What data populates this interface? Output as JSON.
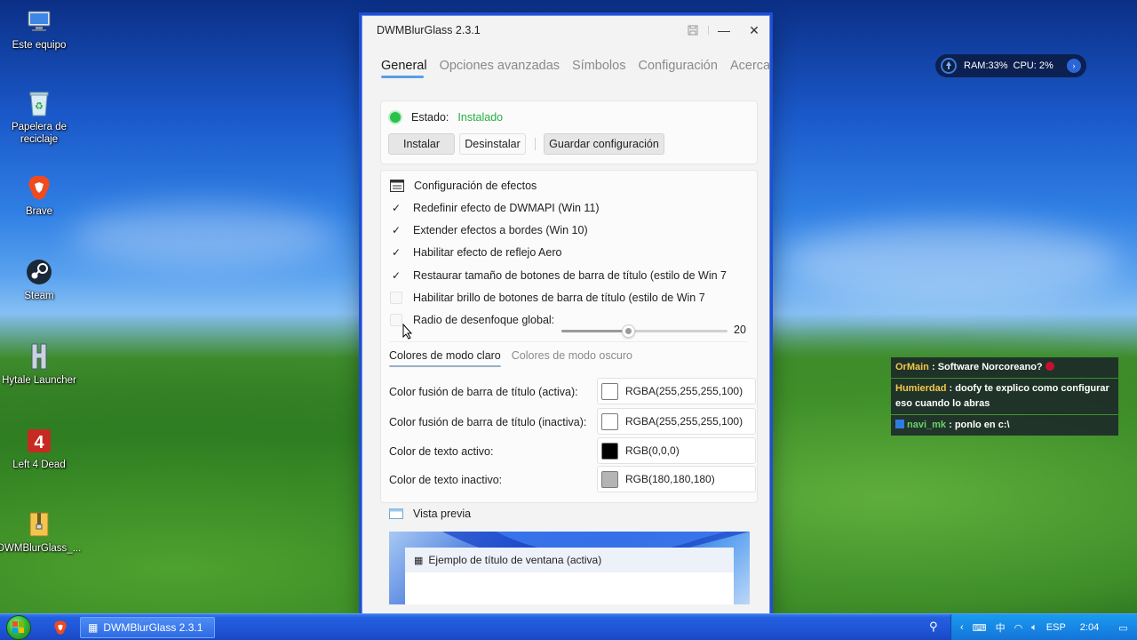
{
  "desktop": {
    "icons": [
      {
        "label": "Este equipo",
        "icon": "computer-icon"
      },
      {
        "label": "Papelera de reciclaje",
        "icon": "recycle-bin-icon"
      },
      {
        "label": "Brave",
        "icon": "brave-icon"
      },
      {
        "label": "Steam",
        "icon": "steam-icon"
      },
      {
        "label": "Hytale Launcher",
        "icon": "hytale-icon"
      },
      {
        "label": "Left 4 Dead",
        "icon": "left4dead-icon"
      },
      {
        "label": "DWMBlurGlass_...",
        "icon": "zip-folder-icon"
      }
    ]
  },
  "widget": {
    "ram": "RAM:33%",
    "cpu": "CPU: 2%"
  },
  "chat": [
    {
      "user": "OrMain",
      "text": ": Software Norcoreano?"
    },
    {
      "user": "Humierdad",
      "text": ": doofy te explico como configurar eso cuando lo abras"
    },
    {
      "user": "navi_mk",
      "text": ": ponlo en c:\\"
    }
  ],
  "window": {
    "title": "DWMBlurGlass 2.3.1",
    "tabs": [
      "General",
      "Opciones avanzadas",
      "Símbolos",
      "Configuración",
      "Acerca de"
    ],
    "status": {
      "label": "Estado:",
      "value": "Instalado"
    },
    "buttons": {
      "install": "Instalar",
      "uninstall": "Desinstalar",
      "save": "Guardar configuración"
    },
    "effects": {
      "title": "Configuración de efectos",
      "options": [
        {
          "label": "Redefinir efecto de DWMAPI (Win 11)",
          "checked": true
        },
        {
          "label": "Extender efectos a bordes (Win 10)",
          "checked": true
        },
        {
          "label": "Habilitar efecto de reflejo Aero",
          "checked": true
        },
        {
          "label": "Restaurar tamaño de botones de barra de título (estilo de Win 7",
          "checked": true
        },
        {
          "label": "Habilitar brillo de botones de barra de título (estilo de Win 7",
          "checked": false
        }
      ],
      "blur": {
        "label": "Radio de desenfoque global:",
        "value": "20",
        "fraction": 0.4
      }
    },
    "color_tabs": [
      "Colores de modo claro",
      "Colores de modo oscuro"
    ],
    "colors": [
      {
        "label": "Color fusión de barra de título (activa):",
        "value": "RGBA(255,255,255,100)",
        "swatch": "#ffffff"
      },
      {
        "label": "Color fusión de barra de título (inactiva):",
        "value": "RGBA(255,255,255,100)",
        "swatch": "#ffffff"
      },
      {
        "label": "Color de texto activo:",
        "value": "RGB(0,0,0)",
        "swatch": "#000000"
      },
      {
        "label": "Color de texto inactivo:",
        "value": "RGB(180,180,180)",
        "swatch": "#b4b4b4"
      }
    ],
    "preview": {
      "title": "Vista previa",
      "sample_title": "Ejemplo de título de ventana (activa)"
    }
  },
  "taskbar": {
    "task": "DWMBlurGlass 2.3.1",
    "lang": "ESP",
    "time": "2:04"
  },
  "colors": {
    "accent": "#5a9ee6",
    "status_green": "#24b040",
    "taskbar_blue": "#1f54d6"
  }
}
